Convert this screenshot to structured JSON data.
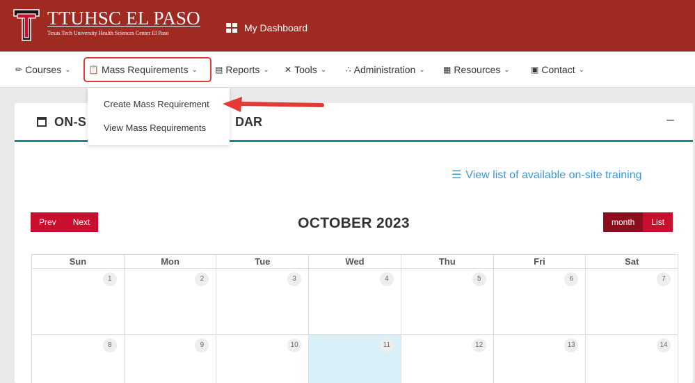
{
  "header": {
    "logo_title": "TTUHSC EL PASO",
    "logo_subtitle": "Texas Tech University Health Sciences Center El Paso",
    "dashboard_label": "My Dashboard",
    "bg_color": "#9e2a22"
  },
  "nav": {
    "items": [
      {
        "label": "Courses",
        "icon": "book-icon"
      },
      {
        "label": "Mass Requirements",
        "icon": "clipboard-icon"
      },
      {
        "label": "Reports",
        "icon": "presentation-icon"
      },
      {
        "label": "Tools",
        "icon": "tools-icon"
      },
      {
        "label": "Administration",
        "icon": "users-icon"
      },
      {
        "label": "Resources",
        "icon": "library-icon"
      },
      {
        "label": "Contact",
        "icon": "contact-icon"
      }
    ]
  },
  "dropdown": {
    "items": [
      {
        "label": "Create Mass Requirement"
      },
      {
        "label": "View Mass Requirements"
      }
    ]
  },
  "card": {
    "title_left": "ON-S",
    "title_right": "DAR",
    "minimize": "−",
    "view_list_label": "View list of available on-site training",
    "accent_color": "#1f8a8a"
  },
  "calendar": {
    "prev_label": "Prev",
    "next_label": "Next",
    "month_label": "OCTOBER 2023",
    "view_month_label": "month",
    "view_list_label": "List",
    "weekdays": [
      "Sun",
      "Mon",
      "Tue",
      "Wed",
      "Thu",
      "Fri",
      "Sat"
    ],
    "weeks": [
      [
        "1",
        "2",
        "3",
        "4",
        "5",
        "6",
        "7"
      ],
      [
        "8",
        "9",
        "10",
        "11",
        "12",
        "13",
        "14"
      ]
    ],
    "today": "11",
    "button_color": "#c8102e"
  }
}
